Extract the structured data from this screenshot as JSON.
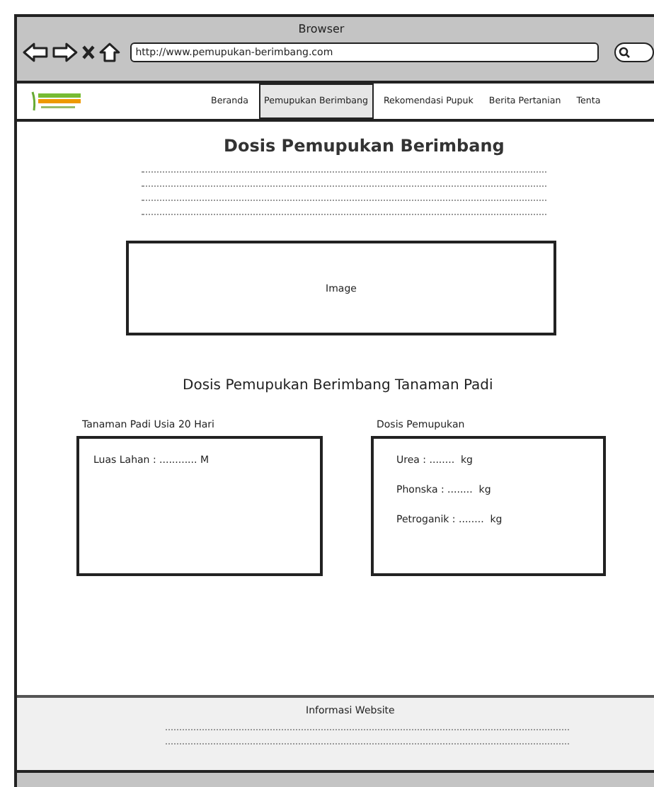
{
  "window": {
    "title": "Browser"
  },
  "toolbar": {
    "url": "http://www.pemupukan-berimbang.com"
  },
  "nav": {
    "items": [
      {
        "label": "Beranda",
        "selected": false
      },
      {
        "label": "Pemupukan Berimbang",
        "selected": true
      },
      {
        "label": "Rekomendasi Pupuk",
        "selected": false
      },
      {
        "label": "Berita Pertanian",
        "selected": false
      },
      {
        "label": "Tenta",
        "selected": false
      }
    ]
  },
  "page": {
    "title": "Dosis Pemupukan Berimbang",
    "image_label": "Image",
    "subtitle": "Dosis Pemupukan Berimbang Tanaman Padi",
    "panels": [
      {
        "label": "Tanaman Padi Usia 20 Hari",
        "fields": [
          "Luas Lahan : ............ M"
        ]
      },
      {
        "label": "Dosis Pemupukan",
        "fields": [
          "Urea : ........  kg",
          "Phonska : ........  kg",
          "Petroganik : ........  kg"
        ]
      }
    ]
  },
  "footer": {
    "title": "Informasi Website"
  }
}
